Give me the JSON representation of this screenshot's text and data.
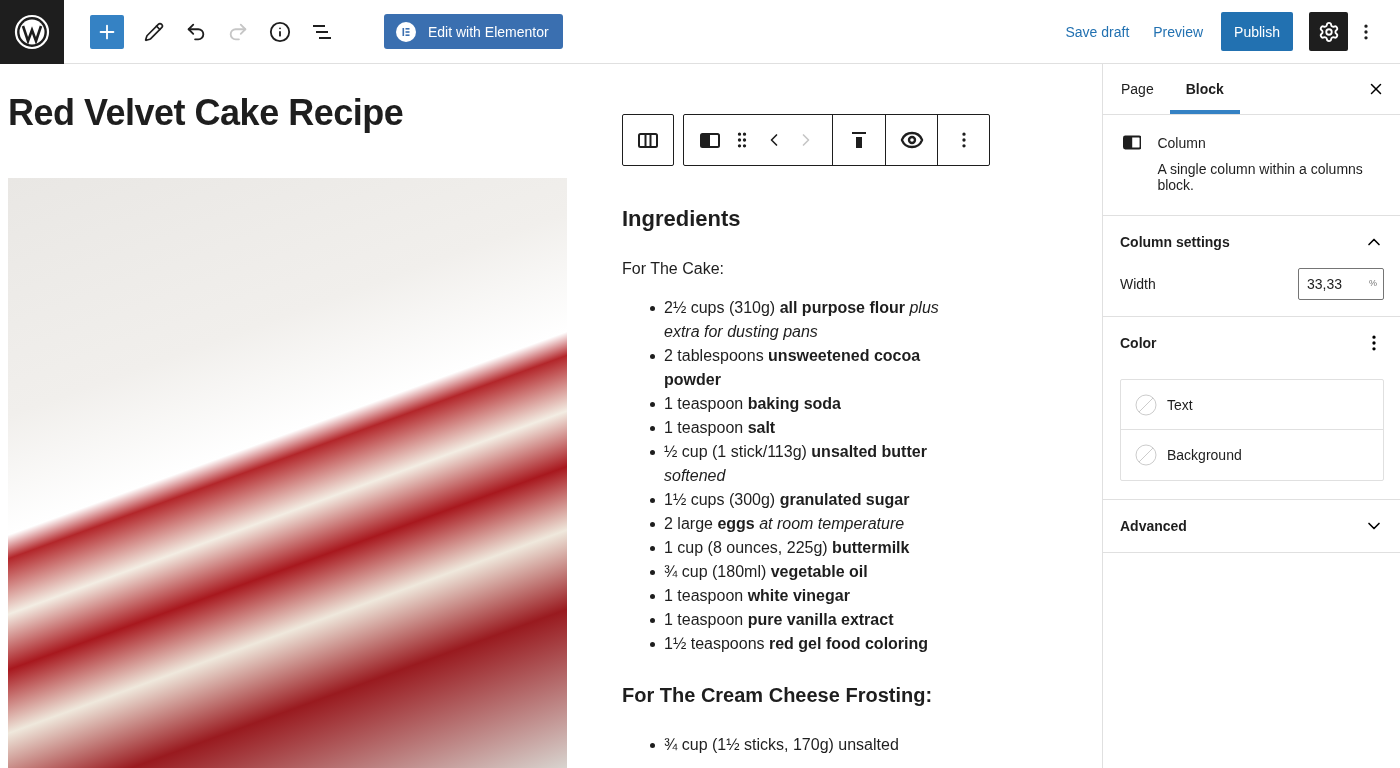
{
  "top_bar": {
    "edit_with_elementor": "Edit with Elementor",
    "redo": {
      "disabled": true
    },
    "save_draft": "Save draft",
    "preview": "Preview",
    "publish": "Publish",
    "settings": {
      "selected": true
    }
  },
  "post_title": "Red Velvet Cake Recipe",
  "block_toolbar": {
    "move_right": {
      "disabled": true
    }
  },
  "content": {
    "heading": "Ingredients",
    "subheading": "For The Cake:",
    "cake_items": [
      "2½ cups (310g) **all purpose flour** *plus extra for dusting pans*",
      "2 tablespoons **unsweetened cocoa powder**",
      "1 teaspoon **baking soda**",
      "1 teaspoon **salt**",
      "½ cup (1 stick/113g) **unsalted butter** *softened*",
      "1½ cups (300g) **granulated sugar**",
      "2 large **eggs** *at room temperature*",
      "1 cup (8 ounces, 225g) **buttermilk**",
      "¾ cup (180ml) **vegetable oil**",
      "1 teaspoon **white vinegar**",
      "1 teaspoon **pure vanilla extract**",
      "1½ teaspoons **red gel food coloring**"
    ],
    "frosting_heading": "For The Cream Cheese Frosting:",
    "frosting_items": [
      "¾ cup (1½ sticks, 170g) unsalted"
    ]
  },
  "sidebar": {
    "tabs": [
      {
        "label": "Page",
        "selected": false
      },
      {
        "label": "Block",
        "selected": true
      }
    ],
    "block_name": "Column",
    "block_description": "A single column within a columns block.",
    "panels": [
      {
        "kind": "settings",
        "title": "Column settings",
        "expanded": true,
        "width_label": "Width",
        "width_value": "33,33",
        "unit": "%"
      },
      {
        "kind": "color",
        "title": "Color",
        "options": [
          "Text",
          "Background"
        ]
      },
      {
        "kind": "plain",
        "title": "Advanced",
        "expanded": false
      }
    ]
  }
}
